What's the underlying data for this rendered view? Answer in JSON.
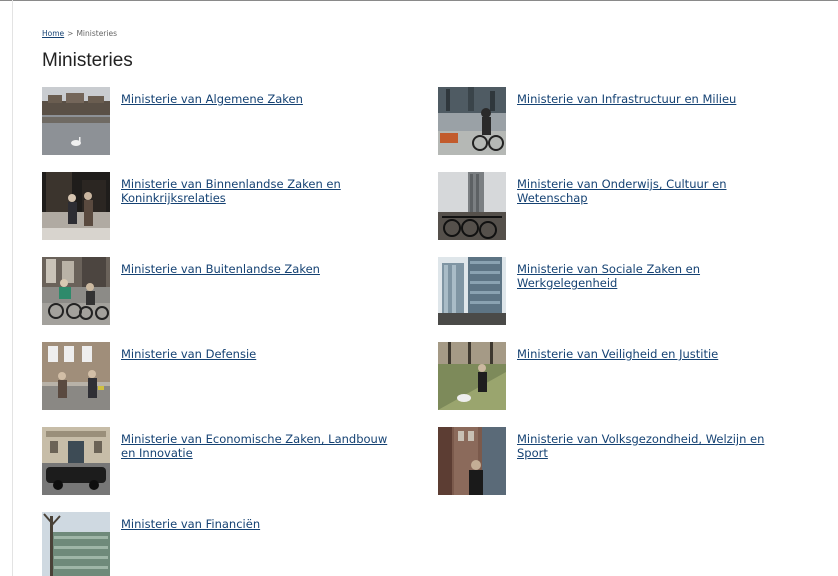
{
  "breadcrumb": {
    "home": "Home",
    "separator": ">",
    "current": "Ministeries"
  },
  "page": {
    "title": "Ministeries"
  },
  "colors": {
    "link": "#154273",
    "title": "#222222"
  },
  "ministries": [
    {
      "label": "Ministerie van Algemene Zaken",
      "photo": "swan-pond-photo"
    },
    {
      "label": "Ministerie van Infrastructuur en Milieu",
      "photo": "cyclist-street-photo"
    },
    {
      "label": "Ministerie van Binnenlandse Zaken en Koninkrijksrelaties",
      "photo": "people-doorway-photo"
    },
    {
      "label": "Ministerie van Onderwijs, Cultuur en Wetenschap",
      "photo": "tower-bikes-photo"
    },
    {
      "label": "Ministerie van Buitenlandse Zaken",
      "photo": "cyclists-photo"
    },
    {
      "label": "Ministerie van Sociale Zaken en Werkgelegenheid",
      "photo": "office-building-photo"
    },
    {
      "label": "Ministerie van Defensie",
      "photo": "pedestrians-street-photo"
    },
    {
      "label": "Ministerie van Veiligheid en Justitie",
      "photo": "person-dog-park-photo"
    },
    {
      "label": "Ministerie van Economische Zaken, Landbouw en Innovatie",
      "photo": "building-car-photo"
    },
    {
      "label": "Ministerie van Volksgezondheid, Welzijn en Sport",
      "photo": "person-phone-photo"
    },
    {
      "label": "Ministerie van Financiën",
      "photo": "office-tree-photo"
    }
  ]
}
